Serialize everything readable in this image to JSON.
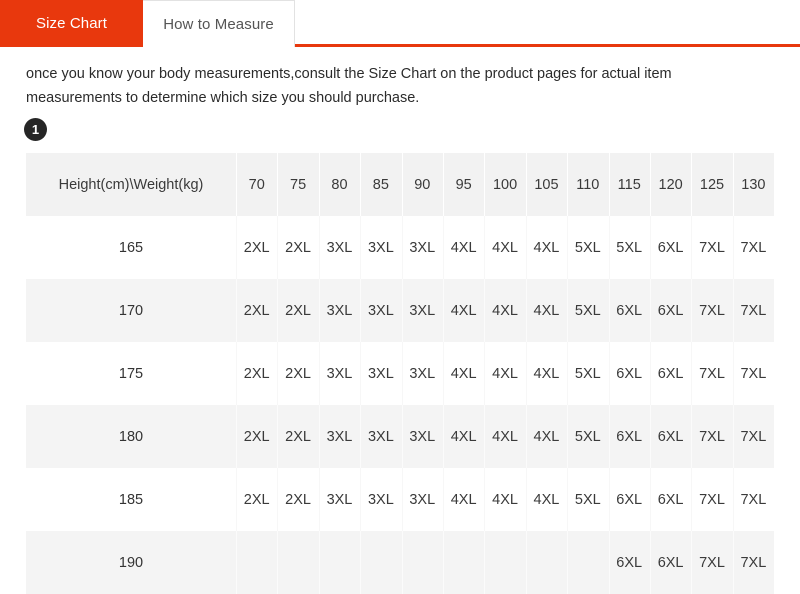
{
  "tabs": [
    {
      "label": "Size Chart",
      "active": true
    },
    {
      "label": "How to Measure",
      "active": false
    }
  ],
  "intro": {
    "text": "once you know your body measurements,consult the Size Chart on the product pages for actual item measurements to determine which size you should purchase."
  },
  "step_badge": {
    "number": "1"
  },
  "table": {
    "corner_header": "Height(cm)\\Weight(kg)",
    "weight_headers": [
      "70",
      "75",
      "80",
      "85",
      "90",
      "95",
      "100",
      "105",
      "110",
      "115",
      "120",
      "125",
      "130"
    ],
    "rows": [
      {
        "height": "165",
        "sizes": [
          "2XL",
          "2XL",
          "3XL",
          "3XL",
          "3XL",
          "4XL",
          "4XL",
          "4XL",
          "5XL",
          "5XL",
          "6XL",
          "7XL",
          "7XL"
        ]
      },
      {
        "height": "170",
        "sizes": [
          "2XL",
          "2XL",
          "3XL",
          "3XL",
          "3XL",
          "4XL",
          "4XL",
          "4XL",
          "5XL",
          "6XL",
          "6XL",
          "7XL",
          "7XL"
        ]
      },
      {
        "height": "175",
        "sizes": [
          "2XL",
          "2XL",
          "3XL",
          "3XL",
          "3XL",
          "4XL",
          "4XL",
          "4XL",
          "5XL",
          "6XL",
          "6XL",
          "7XL",
          "7XL"
        ]
      },
      {
        "height": "180",
        "sizes": [
          "2XL",
          "2XL",
          "3XL",
          "3XL",
          "3XL",
          "4XL",
          "4XL",
          "4XL",
          "5XL",
          "6XL",
          "6XL",
          "7XL",
          "7XL"
        ]
      },
      {
        "height": "185",
        "sizes": [
          "2XL",
          "2XL",
          "3XL",
          "3XL",
          "3XL",
          "4XL",
          "4XL",
          "4XL",
          "5XL",
          "6XL",
          "6XL",
          "7XL",
          "7XL"
        ]
      },
      {
        "height": "190",
        "sizes": [
          "",
          "",
          "",
          "",
          "",
          "",
          "",
          "",
          "",
          "6XL",
          "6XL",
          "7XL",
          "7XL"
        ]
      }
    ]
  },
  "colors": {
    "accent": "#e8380d",
    "header_row_bg": "#f2f2f2",
    "stripe_bg": "#f4f4f4",
    "badge_bg": "#262626",
    "text": "#333333"
  }
}
